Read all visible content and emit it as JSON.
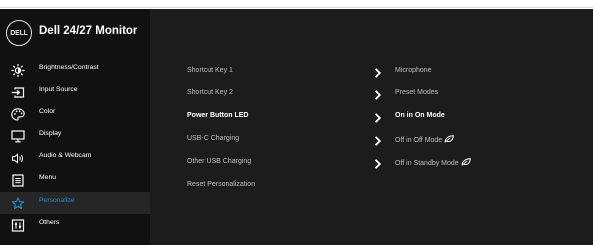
{
  "header": {
    "logo_text": "DELL",
    "title": "Dell 24/27 Monitor"
  },
  "sidebar": {
    "items": [
      {
        "label": "Brightness/Contrast",
        "icon": "brightness-icon",
        "active": false
      },
      {
        "label": "Input Source",
        "icon": "input-source-icon",
        "active": false
      },
      {
        "label": "Color",
        "icon": "color-palette-icon",
        "active": false
      },
      {
        "label": "Display",
        "icon": "display-monitor-icon",
        "active": false
      },
      {
        "label": "Audio & Webcam",
        "icon": "speaker-icon",
        "active": false
      },
      {
        "label": "Menu",
        "icon": "menu-icon",
        "active": false
      },
      {
        "label": "Personalize",
        "icon": "star-icon",
        "active": true
      },
      {
        "label": "Others",
        "icon": "others-icon",
        "active": false
      }
    ]
  },
  "settings": {
    "rows": [
      {
        "label": "Shortcut Key 1",
        "value": "Microphone",
        "selected": false
      },
      {
        "label": "Shortcut Key 2",
        "value": "Preset Modes",
        "selected": false
      },
      {
        "label": "Power Button LED",
        "value": "On in On Mode",
        "selected": true
      },
      {
        "label": "USB-C Charging",
        "value": "Off in Off Mode",
        "selected": false,
        "eco_icon": true
      },
      {
        "label": "Other USB Charging",
        "value": "Off in Standby Mode",
        "selected": false,
        "eco_icon": true
      },
      {
        "label": "Reset Personalization",
        "value": "",
        "selected": false
      }
    ]
  },
  "colors": {
    "accent": "#1a8fd6",
    "sidebar_bg": "#111111",
    "panel_bg": "#1c1c1c",
    "active_item_bg": "#262626"
  }
}
